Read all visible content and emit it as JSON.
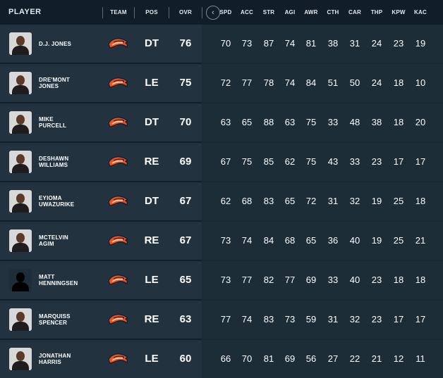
{
  "header": {
    "player": "PLAYER",
    "team": "TEAM",
    "pos": "POS",
    "ovr": "OVR",
    "collapse_icon": "chevron-left-icon",
    "stat_columns": [
      "SPD",
      "ACC",
      "STR",
      "AGI",
      "AWR",
      "CTH",
      "CAR",
      "THP",
      "KPW",
      "KAC"
    ]
  },
  "colors": {
    "background": "#131f29",
    "row": "#22333f",
    "stats_panel": "#1c2d38",
    "team_orange": "#fb4f14",
    "team_navy": "#002244"
  },
  "players": [
    {
      "name_line1": "D.J. JONES",
      "name_line2": "",
      "pos": "DT",
      "ovr": "76",
      "avatar": "photo",
      "stats": [
        "70",
        "73",
        "87",
        "74",
        "81",
        "38",
        "31",
        "24",
        "23",
        "19"
      ]
    },
    {
      "name_line1": "DRE'MONT",
      "name_line2": "JONES",
      "pos": "LE",
      "ovr": "75",
      "avatar": "photo",
      "stats": [
        "72",
        "77",
        "78",
        "74",
        "84",
        "51",
        "50",
        "24",
        "18",
        "10"
      ]
    },
    {
      "name_line1": "MIKE",
      "name_line2": "PURCELL",
      "pos": "DT",
      "ovr": "70",
      "avatar": "photo",
      "stats": [
        "63",
        "65",
        "88",
        "63",
        "75",
        "33",
        "48",
        "38",
        "18",
        "20"
      ]
    },
    {
      "name_line1": "DESHAWN",
      "name_line2": "WILLIAMS",
      "pos": "RE",
      "ovr": "69",
      "avatar": "photo",
      "stats": [
        "67",
        "75",
        "85",
        "62",
        "75",
        "43",
        "33",
        "23",
        "17",
        "17"
      ]
    },
    {
      "name_line1": "EYIOMA",
      "name_line2": "UWAZURIKE",
      "pos": "DT",
      "ovr": "67",
      "avatar": "photo",
      "stats": [
        "62",
        "68",
        "83",
        "65",
        "72",
        "31",
        "32",
        "19",
        "25",
        "18"
      ]
    },
    {
      "name_line1": "MCTELVIN",
      "name_line2": "AGIM",
      "pos": "RE",
      "ovr": "67",
      "avatar": "photo",
      "stats": [
        "73",
        "74",
        "84",
        "68",
        "65",
        "36",
        "40",
        "19",
        "25",
        "21"
      ]
    },
    {
      "name_line1": "MATT",
      "name_line2": "HENNINGSEN",
      "pos": "LE",
      "ovr": "65",
      "avatar": "silhouette",
      "stats": [
        "73",
        "77",
        "82",
        "77",
        "69",
        "33",
        "40",
        "23",
        "18",
        "18"
      ]
    },
    {
      "name_line1": "MARQUISS",
      "name_line2": "SPENCER",
      "pos": "RE",
      "ovr": "63",
      "avatar": "photo",
      "stats": [
        "77",
        "74",
        "83",
        "73",
        "59",
        "31",
        "32",
        "23",
        "17",
        "17"
      ]
    },
    {
      "name_line1": "JONATHAN",
      "name_line2": "HARRIS",
      "pos": "LE",
      "ovr": "60",
      "avatar": "photo",
      "stats": [
        "66",
        "70",
        "81",
        "69",
        "56",
        "27",
        "22",
        "21",
        "12",
        "11"
      ]
    }
  ]
}
